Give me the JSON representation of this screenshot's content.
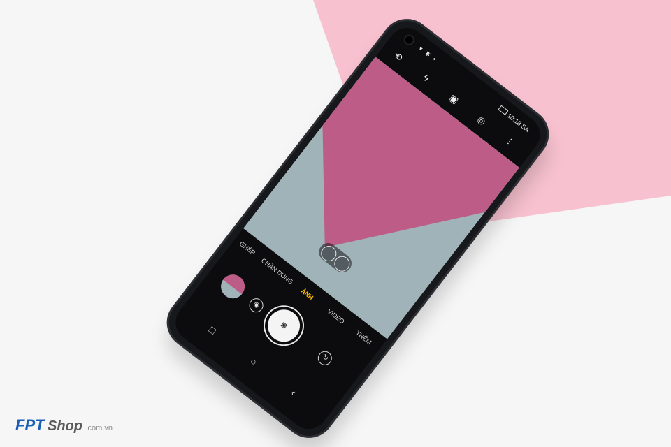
{
  "colors": {
    "background_white": "#f6f6f6",
    "background_pink": "#f7c1cf",
    "phone_body": "#17181b",
    "viewfinder_pink": "#bd5d87",
    "viewfinder_blue": "#9fb3b8",
    "active_mode": "#f5b400"
  },
  "status_bar": {
    "time": "10:18 SA"
  },
  "camera_modes": [
    {
      "label": "GHÉP"
    },
    {
      "label": "CHÂN DUNG"
    },
    {
      "label": "ẢNH"
    },
    {
      "label": "VIDEO"
    },
    {
      "label": "THÊM"
    }
  ],
  "icons": {
    "topbar": [
      "ai-cam-icon",
      "flash-off-icon",
      "hdr-icon",
      "timer-icon",
      "settings-sliders-icon"
    ],
    "controls": [
      "gallery-thumbnail",
      "lens-switch-icon",
      "shutter-button",
      "flip-camera-icon"
    ],
    "nav": [
      "recents-icon",
      "home-icon",
      "back-icon"
    ]
  },
  "watermark": {
    "brand_fpt": "FPT",
    "brand_shop": "Shop",
    "brand_domain": ".com.vn"
  }
}
